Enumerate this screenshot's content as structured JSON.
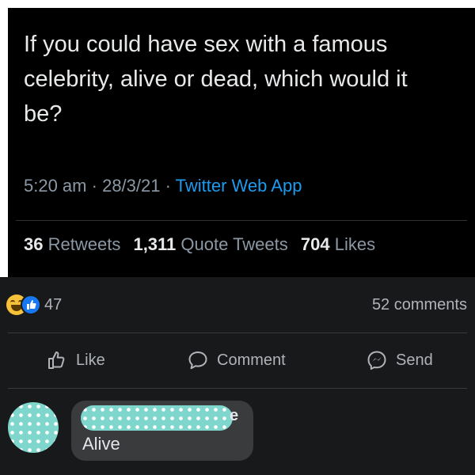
{
  "tweet": {
    "text": "If you could have sex with a famous celebrity, alive or dead, which would it be?",
    "time": "5:20 am",
    "date": "28/3/21",
    "source": "Twitter Web App",
    "stats": {
      "retweets_count": "36",
      "retweets_label": "Retweets",
      "quotes_count": "1,311",
      "quotes_label": "Quote Tweets",
      "likes_count": "704",
      "likes_label": "Likes"
    }
  },
  "facebook_post": {
    "reaction_icons": [
      "haha-reaction-icon",
      "like-reaction-icon"
    ],
    "reaction_count": "47",
    "comments_count": "52 comments",
    "actions": {
      "like": "Like",
      "comment": "Comment",
      "send": "Send"
    },
    "comment": {
      "author_visible_suffix": "e",
      "text": "Alive"
    }
  },
  "colors": {
    "tweet_bg": "#000000",
    "twitter_blue": "#1d9bf0",
    "fb_bg": "#18191a",
    "comment_bubble": "#3a3b3c",
    "redaction_teal": "#7fd6cc"
  }
}
